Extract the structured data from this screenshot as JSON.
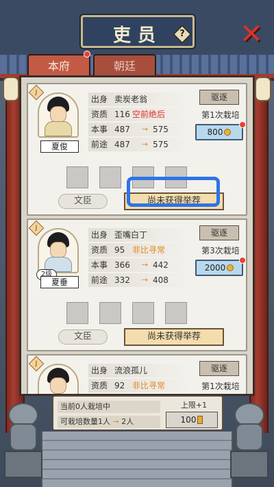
{
  "header": {
    "title": "吏员",
    "help_icon": "?",
    "close_icon": "✕"
  },
  "tabs": [
    {
      "label": "本府",
      "active": true
    },
    {
      "label": "朝廷",
      "active": false
    }
  ],
  "labels": {
    "origin": "出身",
    "aptitude": "资质",
    "ability": "本事",
    "prospect": "前途",
    "expel": "驱逐",
    "civil": "文臣",
    "recommend": "尚未获得举荐"
  },
  "officials": [
    {
      "name": "夏俊",
      "rank_badge": "J",
      "origin": "卖炭老翁",
      "aptitude": "116",
      "quality": "空前绝后",
      "quality_color": "#e0322a",
      "ability": "487",
      "ability_next": "575",
      "prospect": "487",
      "prospect_next": "575",
      "cultivate": "第1次栽培",
      "cost": "800"
    },
    {
      "name": "夏垂",
      "rank_badge": "J",
      "level": "2级",
      "origin": "歪嘴白丁",
      "aptitude": "95",
      "quality": "非比寻常",
      "quality_color": "#e08a24",
      "ability": "366",
      "ability_next": "442",
      "prospect": "332",
      "prospect_next": "408",
      "cultivate": "第3次栽培",
      "cost": "2000"
    },
    {
      "name": "",
      "rank_badge": "J",
      "origin": "流浪孤儿",
      "aptitude": "92",
      "quality": "非比寻常",
      "quality_color": "#e08a24",
      "cultivate": "第1次栽培"
    }
  ],
  "bottom": {
    "current": "当前0人栽培中",
    "capacity_prefix": "可栽培数量1人",
    "capacity_next": "2人",
    "cap_label": "上限+1",
    "cap_cost": "100"
  },
  "colors": {
    "accent_red": "#c25a46",
    "highlight_blue": "#2c74e8"
  }
}
